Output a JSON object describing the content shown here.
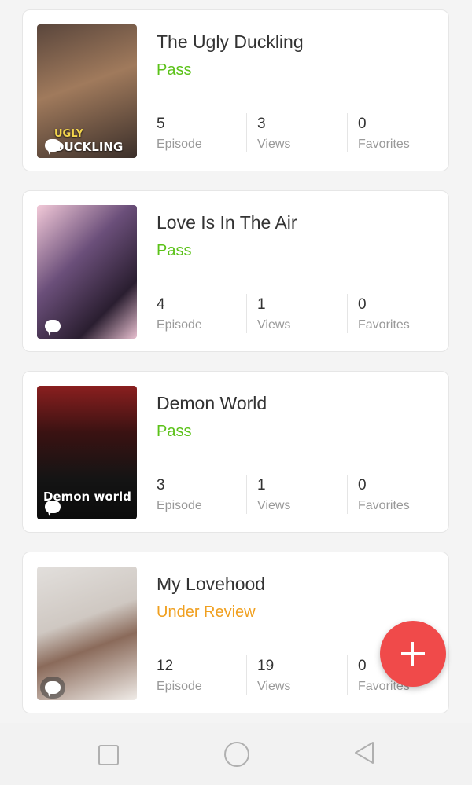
{
  "dramas": [
    {
      "title": "The Ugly Duckling",
      "status": "Pass",
      "status_color": "#5bc219",
      "cover_text_top": "UGLY",
      "cover_text_bottom": "DUCKLING",
      "cover_colors": [
        "#3b2f2a",
        "#a07a5c"
      ],
      "episodes": "5",
      "views": "3",
      "favorites": "0",
      "episode_label": "Episode",
      "views_label": "Views",
      "favorites_label": "Favorites"
    },
    {
      "title": "Love Is In The Air",
      "status": "Pass",
      "status_color": "#5bc219",
      "cover_text_top": "",
      "cover_text_bottom": "",
      "cover_colors": [
        "#e8b9cc",
        "#3a2a46"
      ],
      "episodes": "4",
      "views": "1",
      "favorites": "0",
      "episode_label": "Episode",
      "views_label": "Views",
      "favorites_label": "Favorites"
    },
    {
      "title": "Demon World",
      "status": "Pass",
      "status_color": "#5bc219",
      "cover_text_top": "",
      "cover_text_bottom": "Demon world",
      "cover_colors": [
        "#7a1a1a",
        "#151515"
      ],
      "episodes": "3",
      "views": "1",
      "favorites": "0",
      "episode_label": "Episode",
      "views_label": "Views",
      "favorites_label": "Favorites"
    },
    {
      "title": "My Lovehood",
      "status": "Under Review",
      "status_color": "#f0a020",
      "cover_text_top": "",
      "cover_text_bottom": "",
      "cover_colors": [
        "#d9d5d2",
        "#8a6a5a"
      ],
      "episodes": "12",
      "views": "19",
      "favorites": "0",
      "episode_label": "Episode",
      "views_label": "Views",
      "favorites_label": "Favorites"
    }
  ],
  "icons": {
    "fab": "plus-icon",
    "comment": "comment-icon",
    "nav": [
      "square-icon",
      "circle-icon",
      "back-triangle-icon"
    ]
  }
}
